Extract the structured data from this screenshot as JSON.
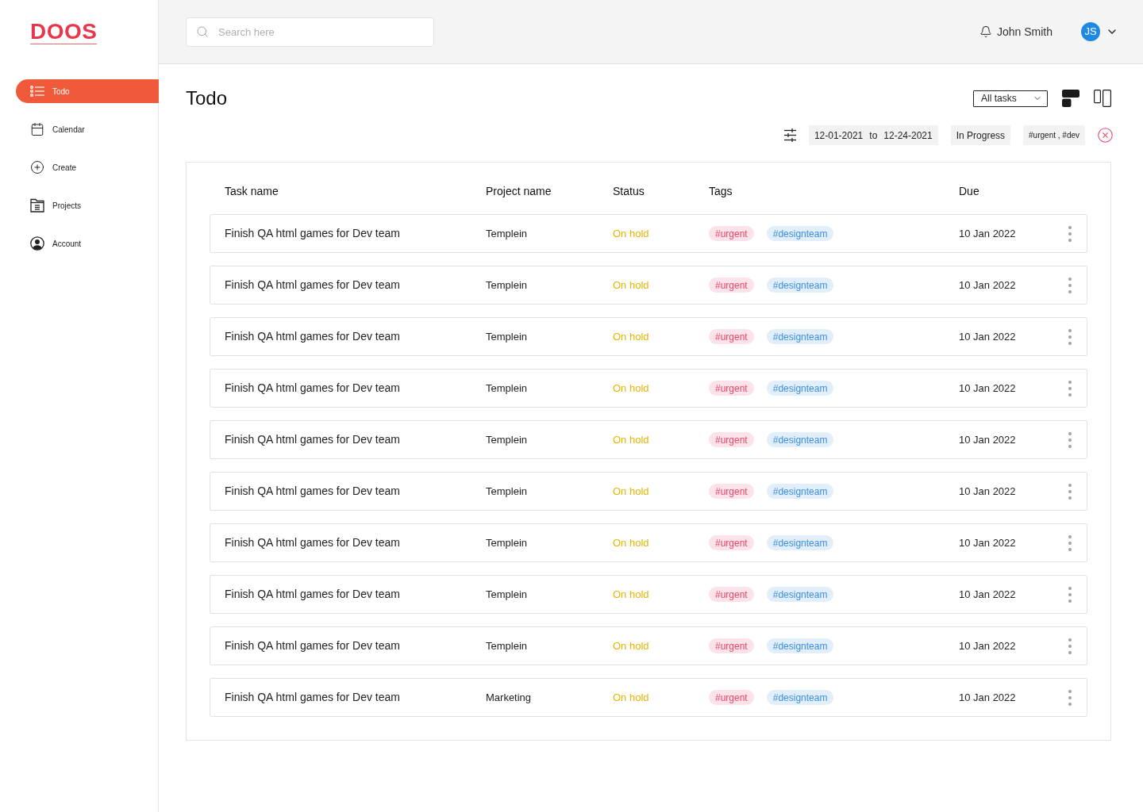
{
  "logo": "DOOS",
  "sidebar": {
    "items": [
      {
        "label": "Todo",
        "selected": true
      },
      {
        "label": "Calendar",
        "selected": false
      },
      {
        "label": "Create",
        "selected": false
      },
      {
        "label": "Projects",
        "selected": false
      },
      {
        "label": "Account",
        "selected": false
      }
    ]
  },
  "header": {
    "search": {
      "placeholder": "Search here"
    },
    "user": {
      "name": "John Smith",
      "initials": "JS"
    }
  },
  "page": {
    "title": "Todo",
    "task_filter": "All tasks",
    "view_toggles": [
      {
        "selected": true
      },
      {
        "selected": false
      }
    ],
    "filters": {
      "date_from": "12-01-2021",
      "date_separator": "to",
      "date_to": "12-24-2021",
      "status": "In Progress",
      "tags": "#urgent , #dev"
    }
  },
  "table": {
    "columns": [
      "Task name",
      "Project name",
      "Status",
      "Tags",
      "Due"
    ],
    "rows": [
      {
        "task": "Finish QA html games for Dev team",
        "project": "Templein",
        "status": "On hold",
        "tags": [
          {
            "label": "#urgent",
            "color": "#e8466a"
          },
          {
            "label": "#designteam",
            "color": "#3b8fe0"
          }
        ],
        "due": "10 Jan 2022"
      },
      {
        "task": "Finish QA html games for Dev team",
        "project": "Templein",
        "status": "On hold",
        "tags": [
          {
            "label": "#urgent",
            "color": "#e8466a"
          },
          {
            "label": "#designteam",
            "color": "#3b8fe0"
          }
        ],
        "due": "10 Jan 2022"
      },
      {
        "task": "Finish QA html games for Dev team",
        "project": "Templein",
        "status": "On hold",
        "tags": [
          {
            "label": "#urgent",
            "color": "#e8466a"
          },
          {
            "label": "#designteam",
            "color": "#3b8fe0"
          }
        ],
        "due": "10 Jan 2022"
      },
      {
        "task": "Finish QA html games for Dev team",
        "project": "Templein",
        "status": "On hold",
        "tags": [
          {
            "label": "#urgent",
            "color": "#e8466a"
          },
          {
            "label": "#designteam",
            "color": "#3b8fe0"
          }
        ],
        "due": "10 Jan 2022"
      },
      {
        "task": "Finish QA html games for Dev team",
        "project": "Templein",
        "status": "On hold",
        "tags": [
          {
            "label": "#urgent",
            "color": "#e8466a"
          },
          {
            "label": "#designteam",
            "color": "#3b8fe0"
          }
        ],
        "due": "10 Jan 2022"
      },
      {
        "task": "Finish QA html games for Dev team",
        "project": "Templein",
        "status": "On hold",
        "tags": [
          {
            "label": "#urgent",
            "color": "#e8466a"
          },
          {
            "label": "#designteam",
            "color": "#3b8fe0"
          }
        ],
        "due": "10 Jan 2022"
      },
      {
        "task": "Finish QA html games for Dev team",
        "project": "Templein",
        "status": "On hold",
        "tags": [
          {
            "label": "#urgent",
            "color": "#e8466a"
          },
          {
            "label": "#designteam",
            "color": "#3b8fe0"
          }
        ],
        "due": "10 Jan 2022"
      },
      {
        "task": "Finish QA html games for Dev team",
        "project": "Templein",
        "status": "On hold",
        "tags": [
          {
            "label": "#urgent",
            "color": "#e8466a"
          },
          {
            "label": "#designteam",
            "color": "#3b8fe0"
          }
        ],
        "due": "10 Jan 2022"
      },
      {
        "task": "Finish QA html games for Dev team",
        "project": "Templein",
        "status": "On hold",
        "tags": [
          {
            "label": "#urgent",
            "color": "#e8466a"
          },
          {
            "label": "#designteam",
            "color": "#3b8fe0"
          }
        ],
        "due": "10 Jan 2022"
      },
      {
        "task": "Finish QA html games for Dev team",
        "project": "Marketing",
        "status": "On hold",
        "tags": [
          {
            "label": "#urgent",
            "color": "#e8466a"
          },
          {
            "label": "#designteam",
            "color": "#3b8fe0"
          }
        ],
        "due": "10 Jan 2022"
      }
    ]
  }
}
